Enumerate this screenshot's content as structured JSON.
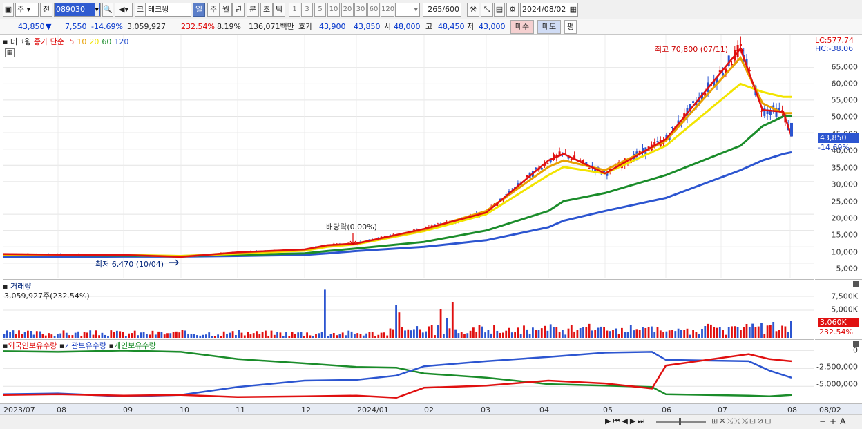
{
  "toolbar": {
    "period_type": "주",
    "prev_label": "전",
    "stock_code": "089030",
    "market_label": "코",
    "stock_name": "테크윙",
    "timeframes": [
      "일",
      "주",
      "월",
      "년",
      "분",
      "초",
      "틱"
    ],
    "active_timeframe": "일",
    "intervals": [
      "1",
      "3",
      "5",
      "10",
      "20",
      "30",
      "60",
      "120"
    ],
    "count_value": "265",
    "count_total": "/600",
    "date_value": "2024/08/02"
  },
  "quote": {
    "price": "43,850",
    "down_arrow": "▼",
    "change": "7,550",
    "change_pct": "-14.69%",
    "volume": "3,059,927",
    "vol_ratio": "232.54%",
    "turnover_rate": "8.19%",
    "amount": "136,071백만",
    "bid_ask_label": "호가",
    "bid": "43,900",
    "ask": "43,850",
    "open_label": "시",
    "open": "48,000",
    "high_label": "고",
    "high": "48,450",
    "low_label": "저",
    "low": "43,000",
    "buy_button": "매수",
    "sell_button": "매도",
    "eval_button": "평"
  },
  "price_panel": {
    "legend_name": "테크윙",
    "legend_close": "종가 단순",
    "ma_labels": [
      "5",
      "10",
      "20",
      "60",
      "120"
    ],
    "ma_colors": [
      "#e01010",
      "#e8a000",
      "#f2e400",
      "#1a8c2a",
      "#2c55d0"
    ],
    "lc_label": "LC:577.74",
    "hc_label": "HC:-38.06",
    "max_annotation": "최고 70,800 (07/11)",
    "min_annotation": "최저 6,470 (10/04)",
    "dividend_annotation": "배당락(0.00%)",
    "current_price_tag": "43,850",
    "current_pct_tag": "-14.69%",
    "y_ticks": [
      "65,000",
      "60,000",
      "55,000",
      "50,000",
      "45,000",
      "40,000",
      "35,000",
      "30,000",
      "25,000",
      "20,000",
      "15,000",
      "10,000",
      "5,000"
    ]
  },
  "volume_panel": {
    "title": "거래량",
    "value_label": "3,059,927주(232.54%)",
    "y_ticks": [
      "7,500K",
      "5,000K"
    ],
    "current_tag": "3,060K",
    "current_pct_tag": "232.54%"
  },
  "holdings_panel": {
    "legend_foreign": "외국인보유수량",
    "legend_inst": "기관보유수량",
    "legend_indiv": "개인보유수량",
    "y_ticks": [
      "0",
      "-2,500,000",
      "-5,000,000"
    ]
  },
  "x_axis": {
    "labels": [
      "2023/07",
      "08",
      "09",
      "10",
      "11",
      "12",
      "2024/01",
      "02",
      "03",
      "04",
      "05",
      "06",
      "07",
      "08"
    ],
    "right_label": "08/02"
  },
  "colors": {
    "up": "#e01010",
    "down": "#2c55d0",
    "foreign": "#e01010",
    "inst": "#2c55d0",
    "indiv": "#1a8c2a",
    "accent": "#5b7ec8"
  },
  "chart_data": {
    "type": "line",
    "title": "테크윙",
    "x_range": [
      "2023/07",
      "2024/08/02"
    ],
    "ylim": [
      2000,
      73000
    ],
    "series": [
      {
        "name": "종가",
        "x": [
          "2023/07",
          "2023/08",
          "2023/09",
          "2023/10",
          "2023/11",
          "2023/12",
          "2023/12/27",
          "2024/01",
          "2024/02",
          "2024/03",
          "2024/04",
          "2024/04/15",
          "2024/05",
          "2024/06",
          "2024/07/11",
          "2024/07",
          "2024/08/01",
          "2024/08/02"
        ],
        "values": [
          7800,
          7600,
          7500,
          6900,
          8300,
          9200,
          10500,
          11000,
          15500,
          20500,
          36500,
          38500,
          32500,
          43000,
          70800,
          52000,
          51400,
          43850
        ]
      },
      {
        "name": "5",
        "values": [
          7700,
          7600,
          7500,
          7000,
          8200,
          9100,
          10300,
          11000,
          15200,
          21000,
          34500,
          36500,
          33500,
          42500,
          68000,
          54000,
          51000,
          51000
        ]
      },
      {
        "name": "20",
        "values": [
          7600,
          7600,
          7500,
          7200,
          7900,
          8800,
          10000,
          10800,
          14800,
          20000,
          32000,
          34500,
          32500,
          41000,
          60000,
          57500,
          56000,
          56000
        ]
      },
      {
        "name": "60",
        "values": [
          7400,
          7400,
          7300,
          7200,
          7500,
          8000,
          8700,
          9500,
          11500,
          15000,
          21000,
          24000,
          26500,
          32000,
          41000,
          47000,
          50000,
          50000
        ]
      },
      {
        "name": "120",
        "values": [
          6800,
          6900,
          7000,
          7000,
          7200,
          7500,
          8000,
          8700,
          10000,
          12000,
          16000,
          18000,
          21000,
          25000,
          33500,
          36500,
          38500,
          39000
        ]
      }
    ],
    "volume": {
      "current": 3059927,
      "ticks_k": [
        5000,
        7500
      ],
      "spikes_k": [
        {
          "x": "2023/12/27",
          "value": 8700
        },
        {
          "x": "2024/01/10",
          "value": 6000
        },
        {
          "x": "2024/02/13",
          "value": 5200
        },
        {
          "x": "2024/02/28",
          "value": 6500
        }
      ]
    },
    "holdings": {
      "ylim": [
        -7000000,
        1000000
      ],
      "foreign": [
        -6200000,
        -6100000,
        -6300000,
        -6200000,
        -6500000,
        -6400000,
        -6300000,
        -6600000,
        -5200000,
        -4900000,
        -4200000,
        -4600000,
        -5300000,
        -2100000,
        -500000,
        -1200000,
        -1500000
      ],
      "inst": [
        -6100000,
        -6000000,
        -6400000,
        -6200000,
        -5100000,
        -4200000,
        -4100000,
        -3500000,
        -2200000,
        -1500000,
        -900000,
        -300000,
        -200000,
        -1300000,
        -1500000,
        -2800000,
        -3800000
      ],
      "indiv": [
        -100000,
        -200000,
        0,
        -200000,
        -1200000,
        -1800000,
        -2300000,
        -2400000,
        -3200000,
        -3800000,
        -4700000,
        -4900000,
        -5100000,
        -6100000,
        -6300000,
        -6400000,
        -6200000
      ]
    }
  }
}
